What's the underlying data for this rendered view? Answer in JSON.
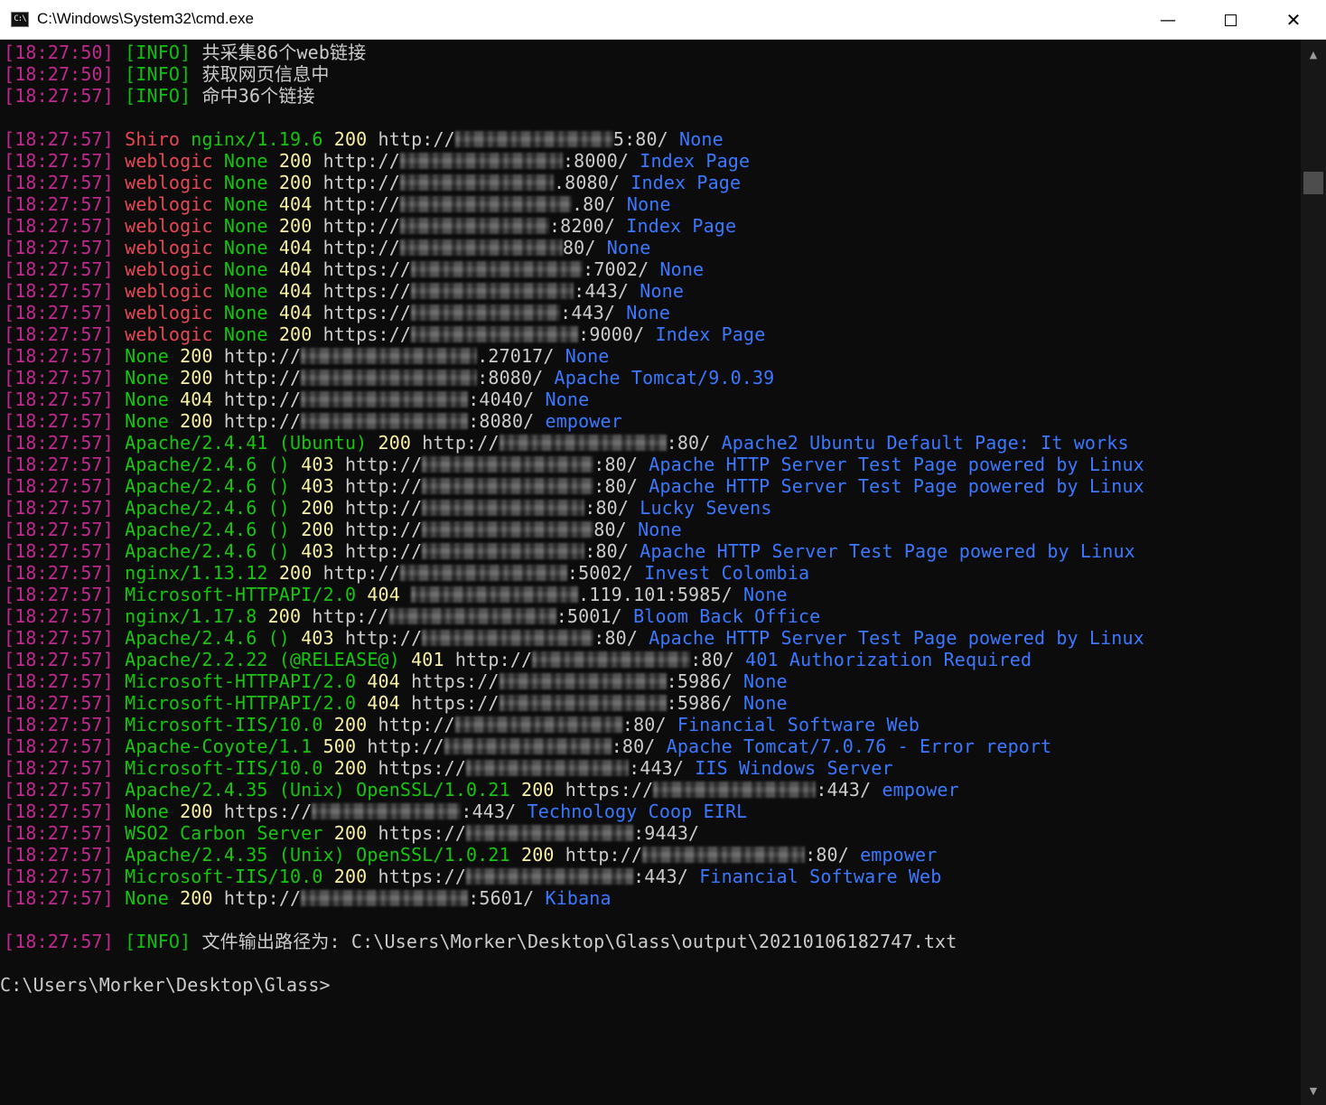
{
  "window": {
    "title": "C:\\Windows\\System32\\cmd.exe",
    "icon": "cmd-icon",
    "icon_glyph": "C:\\",
    "min_glyph": "—",
    "close_glyph": "✕"
  },
  "colors": {
    "timestamp": "#c2288f",
    "info_tag": "#10c010",
    "red": "#e74856",
    "green": "#16c60c",
    "yellow": "#f9f1a5",
    "white": "#cccccc",
    "blue": "#3b78ff"
  },
  "console": {
    "info_top": [
      {
        "ts": "[18:27:50]",
        "tag": "[INFO]",
        "msg": "共采集86个web链接"
      },
      {
        "ts": "[18:27:50]",
        "tag": "[INFO]",
        "msg": "获取网页信息中"
      },
      {
        "ts": "[18:27:57]",
        "tag": "[INFO]",
        "msg": "命中36个链接"
      }
    ],
    "results": [
      {
        "ts": "[18:27:57]",
        "segs": [
          {
            "t": "Shiro ",
            "c": "red"
          },
          {
            "t": "nginx/1.19.6 ",
            "c": "grn"
          },
          {
            "t": "200 ",
            "c": "yel"
          },
          {
            "t": "http://",
            "c": "wht"
          },
          {
            "b": 175
          },
          {
            "t": "5:80/ ",
            "c": "wht"
          },
          {
            "t": "None",
            "c": "blu"
          }
        ]
      },
      {
        "ts": "[18:27:57]",
        "segs": [
          {
            "t": "weblogic ",
            "c": "red"
          },
          {
            "t": "None ",
            "c": "grn"
          },
          {
            "t": "200 ",
            "c": "yel"
          },
          {
            "t": "http://",
            "c": "wht"
          },
          {
            "b": 180
          },
          {
            "t": ":8000/ ",
            "c": "wht"
          },
          {
            "t": "Index Page",
            "c": "blu"
          }
        ]
      },
      {
        "ts": "[18:27:57]",
        "segs": [
          {
            "t": "weblogic ",
            "c": "red"
          },
          {
            "t": "None ",
            "c": "grn"
          },
          {
            "t": "200 ",
            "c": "yel"
          },
          {
            "t": "http://",
            "c": "wht"
          },
          {
            "b": 170
          },
          {
            "t": ".8080/ ",
            "c": "wht"
          },
          {
            "t": "Index Page",
            "c": "blu"
          }
        ]
      },
      {
        "ts": "[18:27:57]",
        "segs": [
          {
            "t": "weblogic ",
            "c": "red"
          },
          {
            "t": "None ",
            "c": "grn"
          },
          {
            "t": "404 ",
            "c": "yel"
          },
          {
            "t": "http://",
            "c": "wht"
          },
          {
            "b": 190
          },
          {
            "t": ".80/ ",
            "c": "wht"
          },
          {
            "t": "None",
            "c": "blu"
          }
        ]
      },
      {
        "ts": "[18:27:57]",
        "segs": [
          {
            "t": "weblogic ",
            "c": "red"
          },
          {
            "t": "None ",
            "c": "grn"
          },
          {
            "t": "200 ",
            "c": "yel"
          },
          {
            "t": "http://",
            "c": "wht"
          },
          {
            "b": 165
          },
          {
            "t": ":8200/ ",
            "c": "wht"
          },
          {
            "t": "Index Page",
            "c": "blu"
          }
        ]
      },
      {
        "ts": "[18:27:57]",
        "segs": [
          {
            "t": "weblogic ",
            "c": "red"
          },
          {
            "t": "None ",
            "c": "grn"
          },
          {
            "t": "404 ",
            "c": "yel"
          },
          {
            "t": "http://",
            "c": "wht"
          },
          {
            "b": 180
          },
          {
            "t": "80/ ",
            "c": "wht"
          },
          {
            "t": "None",
            "c": "blu"
          }
        ]
      },
      {
        "ts": "[18:27:57]",
        "segs": [
          {
            "t": "weblogic ",
            "c": "red"
          },
          {
            "t": "None ",
            "c": "grn"
          },
          {
            "t": "404 ",
            "c": "yel"
          },
          {
            "t": "https://",
            "c": "wht"
          },
          {
            "b": 190
          },
          {
            "t": ":7002/ ",
            "c": "wht"
          },
          {
            "t": "None",
            "c": "blu"
          }
        ]
      },
      {
        "ts": "[18:27:57]",
        "segs": [
          {
            "t": "weblogic ",
            "c": "red"
          },
          {
            "t": "None ",
            "c": "grn"
          },
          {
            "t": "404 ",
            "c": "yel"
          },
          {
            "t": "https://",
            "c": "wht"
          },
          {
            "b": 180
          },
          {
            "t": ":443/ ",
            "c": "wht"
          },
          {
            "t": "None",
            "c": "blu"
          }
        ]
      },
      {
        "ts": "[18:27:57]",
        "segs": [
          {
            "t": "weblogic ",
            "c": "red"
          },
          {
            "t": "None ",
            "c": "grn"
          },
          {
            "t": "404 ",
            "c": "yel"
          },
          {
            "t": "https://",
            "c": "wht"
          },
          {
            "b": 165
          },
          {
            "t": ":443/ ",
            "c": "wht"
          },
          {
            "t": "None",
            "c": "blu"
          }
        ]
      },
      {
        "ts": "[18:27:57]",
        "segs": [
          {
            "t": "weblogic ",
            "c": "red"
          },
          {
            "t": "None ",
            "c": "grn"
          },
          {
            "t": "200 ",
            "c": "yel"
          },
          {
            "t": "https://",
            "c": "wht"
          },
          {
            "b": 185
          },
          {
            "t": ":9000/ ",
            "c": "wht"
          },
          {
            "t": "Index Page",
            "c": "blu"
          }
        ]
      },
      {
        "ts": "[18:27:57]",
        "segs": [
          {
            "t": "None ",
            "c": "grn"
          },
          {
            "t": "200 ",
            "c": "yel"
          },
          {
            "t": "http://",
            "c": "wht"
          },
          {
            "b": 195
          },
          {
            "t": ".27017/ ",
            "c": "wht"
          },
          {
            "t": "None",
            "c": "blu"
          }
        ]
      },
      {
        "ts": "[18:27:57]",
        "segs": [
          {
            "t": "None ",
            "c": "grn"
          },
          {
            "t": "200 ",
            "c": "yel"
          },
          {
            "t": "http://",
            "c": "wht"
          },
          {
            "b": 195
          },
          {
            "t": ":8080/ ",
            "c": "wht"
          },
          {
            "t": "Apache Tomcat/9.0.39",
            "c": "blu"
          }
        ]
      },
      {
        "ts": "[18:27:57]",
        "segs": [
          {
            "t": "None ",
            "c": "grn"
          },
          {
            "t": "404 ",
            "c": "yel"
          },
          {
            "t": "http://",
            "c": "wht"
          },
          {
            "b": 185
          },
          {
            "t": ":4040/ ",
            "c": "wht"
          },
          {
            "t": "None",
            "c": "blu"
          }
        ]
      },
      {
        "ts": "[18:27:57]",
        "segs": [
          {
            "t": "None ",
            "c": "grn"
          },
          {
            "t": "200 ",
            "c": "yel"
          },
          {
            "t": "http://",
            "c": "wht"
          },
          {
            "b": 185
          },
          {
            "t": ":8080/ ",
            "c": "wht"
          },
          {
            "t": "empower",
            "c": "blu"
          }
        ]
      },
      {
        "ts": "[18:27:57]",
        "segs": [
          {
            "t": "Apache/2.4.41 (Ubuntu) ",
            "c": "grn"
          },
          {
            "t": "200 ",
            "c": "yel"
          },
          {
            "t": "http://",
            "c": "wht"
          },
          {
            "b": 185
          },
          {
            "t": ":80/ ",
            "c": "wht"
          },
          {
            "t": "Apache2 Ubuntu Default Page: It works",
            "c": "blu"
          }
        ]
      },
      {
        "ts": "[18:27:57]",
        "segs": [
          {
            "t": "Apache/2.4.6 () ",
            "c": "grn"
          },
          {
            "t": "403 ",
            "c": "yel"
          },
          {
            "t": "http://",
            "c": "wht"
          },
          {
            "b": 190
          },
          {
            "t": ":80/ ",
            "c": "wht"
          },
          {
            "t": "Apache HTTP Server Test Page powered by Linux",
            "c": "blu"
          }
        ]
      },
      {
        "ts": "[18:27:57]",
        "segs": [
          {
            "t": "Apache/2.4.6 () ",
            "c": "grn"
          },
          {
            "t": "403 ",
            "c": "yel"
          },
          {
            "t": "http://",
            "c": "wht"
          },
          {
            "b": 190
          },
          {
            "t": ":80/ ",
            "c": "wht"
          },
          {
            "t": "Apache HTTP Server Test Page powered by Linux",
            "c": "blu"
          }
        ]
      },
      {
        "ts": "[18:27:57]",
        "segs": [
          {
            "t": "Apache/2.4.6 () ",
            "c": "grn"
          },
          {
            "t": "200 ",
            "c": "yel"
          },
          {
            "t": "http://",
            "c": "wht"
          },
          {
            "b": 180
          },
          {
            "t": ":80/ ",
            "c": "wht"
          },
          {
            "t": "Lucky Sevens",
            "c": "blu"
          }
        ]
      },
      {
        "ts": "[18:27:57]",
        "segs": [
          {
            "t": "Apache/2.4.6 () ",
            "c": "grn"
          },
          {
            "t": "200 ",
            "c": "yel"
          },
          {
            "t": "http://",
            "c": "wht"
          },
          {
            "b": 190
          },
          {
            "t": "80/ ",
            "c": "wht"
          },
          {
            "t": "None",
            "c": "blu"
          }
        ]
      },
      {
        "ts": "[18:27:57]",
        "segs": [
          {
            "t": "Apache/2.4.6 () ",
            "c": "grn"
          },
          {
            "t": "403 ",
            "c": "yel"
          },
          {
            "t": "http://",
            "c": "wht"
          },
          {
            "b": 180
          },
          {
            "t": ":80/ ",
            "c": "wht"
          },
          {
            "t": "Apache HTTP Server Test Page powered by Linux",
            "c": "blu"
          }
        ]
      },
      {
        "ts": "[18:27:57]",
        "segs": [
          {
            "t": "nginx/1.13.12 ",
            "c": "grn"
          },
          {
            "t": "200 ",
            "c": "yel"
          },
          {
            "t": "http://",
            "c": "wht"
          },
          {
            "b": 185
          },
          {
            "t": ":5002/ ",
            "c": "wht"
          },
          {
            "t": "Invest Colombia",
            "c": "blu"
          }
        ]
      },
      {
        "ts": "[18:27:57]",
        "segs": [
          {
            "t": "Microsoft-HTTPAPI/2.0 ",
            "c": "grn"
          },
          {
            "t": "404 ",
            "c": "yel"
          },
          {
            "b": 185
          },
          {
            "t": ".119.101:5985/ ",
            "c": "wht"
          },
          {
            "t": "None",
            "c": "blu"
          }
        ]
      },
      {
        "ts": "[18:27:57]",
        "segs": [
          {
            "t": "nginx/1.17.8 ",
            "c": "grn"
          },
          {
            "t": "200 ",
            "c": "yel"
          },
          {
            "t": "http://",
            "c": "wht"
          },
          {
            "b": 185
          },
          {
            "t": ":5001/ ",
            "c": "wht"
          },
          {
            "t": "Bloom Back Office",
            "c": "blu"
          }
        ]
      },
      {
        "ts": "[18:27:57]",
        "segs": [
          {
            "t": "Apache/2.4.6 () ",
            "c": "grn"
          },
          {
            "t": "403 ",
            "c": "yel"
          },
          {
            "t": "http://",
            "c": "wht"
          },
          {
            "b": 190
          },
          {
            "t": ":80/ ",
            "c": "wht"
          },
          {
            "t": "Apache HTTP Server Test Page powered by Linux",
            "c": "blu"
          }
        ]
      },
      {
        "ts": "[18:27:57]",
        "segs": [
          {
            "t": "Apache/2.2.22 (@RELEASE@) ",
            "c": "grn"
          },
          {
            "t": "401 ",
            "c": "yel"
          },
          {
            "t": "http://",
            "c": "wht"
          },
          {
            "b": 175
          },
          {
            "t": ":80/ ",
            "c": "wht"
          },
          {
            "t": "401 Authorization Required",
            "c": "blu"
          }
        ]
      },
      {
        "ts": "[18:27:57]",
        "segs": [
          {
            "t": "Microsoft-HTTPAPI/2.0 ",
            "c": "grn"
          },
          {
            "t": "404 ",
            "c": "yel"
          },
          {
            "t": "https://",
            "c": "wht"
          },
          {
            "b": 185
          },
          {
            "t": ":5986/ ",
            "c": "wht"
          },
          {
            "t": "None",
            "c": "blu"
          }
        ]
      },
      {
        "ts": "[18:27:57]",
        "segs": [
          {
            "t": "Microsoft-HTTPAPI/2.0 ",
            "c": "grn"
          },
          {
            "t": "404 ",
            "c": "yel"
          },
          {
            "t": "https://",
            "c": "wht"
          },
          {
            "b": 185
          },
          {
            "t": ":5986/ ",
            "c": "wht"
          },
          {
            "t": "None",
            "c": "blu"
          }
        ]
      },
      {
        "ts": "[18:27:57]",
        "segs": [
          {
            "t": "Microsoft-IIS/10.0 ",
            "c": "grn"
          },
          {
            "t": "200 ",
            "c": "yel"
          },
          {
            "t": "http://",
            "c": "wht"
          },
          {
            "b": 185
          },
          {
            "t": ":80/ ",
            "c": "wht"
          },
          {
            "t": "Financial Software Web",
            "c": "blu"
          }
        ]
      },
      {
        "ts": "[18:27:57]",
        "segs": [
          {
            "t": "Apache-Coyote/1.1 ",
            "c": "grn"
          },
          {
            "t": "500 ",
            "c": "yel"
          },
          {
            "t": "http://",
            "c": "wht"
          },
          {
            "b": 185
          },
          {
            "t": ":80/ ",
            "c": "wht"
          },
          {
            "t": "Apache Tomcat/7.0.76 - Error report",
            "c": "blu"
          }
        ]
      },
      {
        "ts": "[18:27:57]",
        "segs": [
          {
            "t": "Microsoft-IIS/10.0 ",
            "c": "grn"
          },
          {
            "t": "200 ",
            "c": "yel"
          },
          {
            "t": "https://",
            "c": "wht"
          },
          {
            "b": 180
          },
          {
            "t": ":443/ ",
            "c": "wht"
          },
          {
            "t": "IIS Windows Server",
            "c": "blu"
          }
        ]
      },
      {
        "ts": "[18:27:57]",
        "segs": [
          {
            "t": "Apache/2.4.35 (Unix) OpenSSL/1.0.21 ",
            "c": "grn"
          },
          {
            "t": "200 ",
            "c": "yel"
          },
          {
            "t": "https://",
            "c": "wht"
          },
          {
            "b": 180
          },
          {
            "t": ":443/ ",
            "c": "wht"
          },
          {
            "t": "empower",
            "c": "blu"
          }
        ]
      },
      {
        "ts": "[18:27:57]",
        "segs": [
          {
            "t": "None ",
            "c": "grn"
          },
          {
            "t": "200 ",
            "c": "yel"
          },
          {
            "t": "https://",
            "c": "wht"
          },
          {
            "b": 165
          },
          {
            "t": ":443/ ",
            "c": "wht"
          },
          {
            "t": "Technology Coop EIRL",
            "c": "blu"
          }
        ]
      },
      {
        "ts": "[18:27:57]",
        "segs": [
          {
            "t": "WSO2 Carbon Server ",
            "c": "grn"
          },
          {
            "t": "200 ",
            "c": "yel"
          },
          {
            "t": "https://",
            "c": "wht"
          },
          {
            "b": 185
          },
          {
            "t": ":9443/",
            "c": "wht"
          }
        ]
      },
      {
        "ts": "[18:27:57]",
        "segs": [
          {
            "t": "Apache/2.4.35 (Unix) OpenSSL/1.0.21 ",
            "c": "grn"
          },
          {
            "t": "200 ",
            "c": "yel"
          },
          {
            "t": "http://",
            "c": "wht"
          },
          {
            "b": 180
          },
          {
            "t": ":80/ ",
            "c": "wht"
          },
          {
            "t": "empower",
            "c": "blu"
          }
        ]
      },
      {
        "ts": "[18:27:57]",
        "segs": [
          {
            "t": "Microsoft-IIS/10.0 ",
            "c": "grn"
          },
          {
            "t": "200 ",
            "c": "yel"
          },
          {
            "t": "https://",
            "c": "wht"
          },
          {
            "b": 185
          },
          {
            "t": ":443/ ",
            "c": "wht"
          },
          {
            "t": "Financial Software Web",
            "c": "blu"
          }
        ]
      },
      {
        "ts": "[18:27:57]",
        "segs": [
          {
            "t": "None ",
            "c": "grn"
          },
          {
            "t": "200 ",
            "c": "yel"
          },
          {
            "t": "http://",
            "c": "wht"
          },
          {
            "b": 185
          },
          {
            "t": ":5601/ ",
            "c": "wht"
          },
          {
            "t": "Kibana",
            "c": "blu"
          }
        ]
      }
    ],
    "info_bottom": {
      "ts": "[18:27:57]",
      "tag": "[INFO]",
      "msg": "文件输出路径为: C:\\Users\\Morker\\Desktop\\Glass\\output\\20210106182747.txt"
    },
    "prompt": "C:\\Users\\Morker\\Desktop\\Glass>"
  },
  "scrollbar": {
    "up_glyph": "▲",
    "down_glyph": "▼"
  }
}
